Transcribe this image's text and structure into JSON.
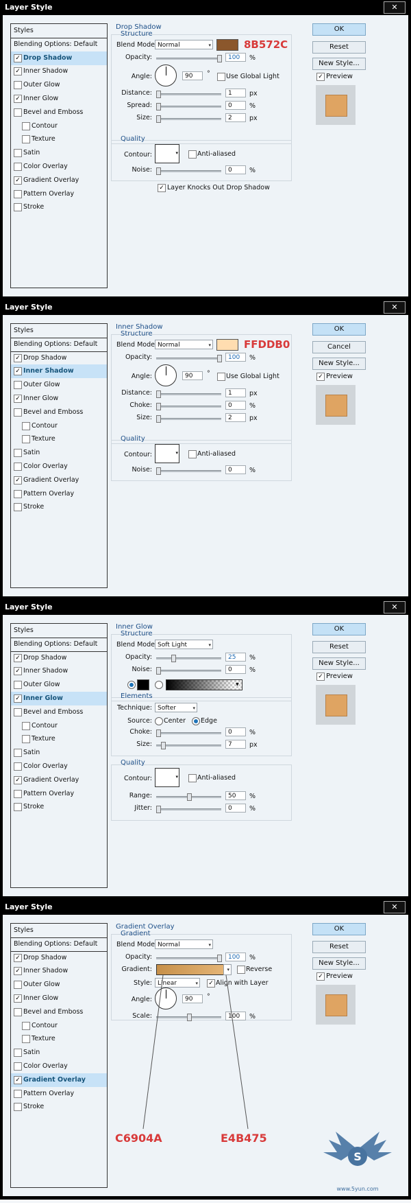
{
  "dialogs": [
    {
      "title": "Layer Style",
      "style_list": {
        "header": "Styles",
        "blending": "Blending Options: Default",
        "items": [
          {
            "label": "Drop Shadow",
            "checked": true,
            "selected": true
          },
          {
            "label": "Inner Shadow",
            "checked": true,
            "selected": false
          },
          {
            "label": "Outer Glow",
            "checked": false,
            "selected": false
          },
          {
            "label": "Inner Glow",
            "checked": true,
            "selected": false
          },
          {
            "label": "Bevel and Emboss",
            "checked": false,
            "selected": false
          },
          {
            "label": "Contour",
            "checked": false,
            "selected": false
          },
          {
            "label": "Texture",
            "checked": false,
            "selected": false
          },
          {
            "label": "Satin",
            "checked": false,
            "selected": false
          },
          {
            "label": "Color Overlay",
            "checked": false,
            "selected": false
          },
          {
            "label": "Gradient Overlay",
            "checked": true,
            "selected": false
          },
          {
            "label": "Pattern Overlay",
            "checked": false,
            "selected": false
          },
          {
            "label": "Stroke",
            "checked": false,
            "selected": false
          }
        ]
      },
      "section_title": "Drop Shadow",
      "structure_title": "Structure",
      "blend_mode_label": "Blend Mode:",
      "blend_mode_value": "Normal",
      "color_hex": "#8B572C",
      "color_annotation": "8B572C",
      "opacity_label": "Opacity:",
      "opacity_value": "100",
      "opacity_level": 1.0,
      "pct": "%",
      "angle_label": "Angle:",
      "angle_value": "90",
      "degree": "°",
      "global_light_label": "Use Global Light",
      "global_light_checked": false,
      "distance_label": "Distance:",
      "distance_value": "1",
      "spread_label": "Spread:",
      "spread_value": "0",
      "size_label": "Size:",
      "size_value": "2",
      "px": "px",
      "quality_title": "Quality",
      "contour_label": "Contour:",
      "anti_aliased_label": "Anti-aliased",
      "noise_label": "Noise:",
      "noise_value": "0",
      "knockout_label": "Layer Knocks Out Drop Shadow",
      "knockout_checked": true,
      "buttons": {
        "ok": "OK",
        "secondary": "Reset",
        "new_style": "New Style...",
        "preview": "Preview"
      }
    },
    {
      "title": "Layer Style",
      "style_list": {
        "header": "Styles",
        "blending": "Blending Options: Default",
        "items": [
          {
            "label": "Drop Shadow",
            "checked": true,
            "selected": false
          },
          {
            "label": "Inner Shadow",
            "checked": true,
            "selected": true
          },
          {
            "label": "Outer Glow",
            "checked": false,
            "selected": false
          },
          {
            "label": "Inner Glow",
            "checked": true,
            "selected": false
          },
          {
            "label": "Bevel and Emboss",
            "checked": false,
            "selected": false
          },
          {
            "label": "Contour",
            "checked": false,
            "selected": false
          },
          {
            "label": "Texture",
            "checked": false,
            "selected": false
          },
          {
            "label": "Satin",
            "checked": false,
            "selected": false
          },
          {
            "label": "Color Overlay",
            "checked": false,
            "selected": false
          },
          {
            "label": "Gradient Overlay",
            "checked": true,
            "selected": false
          },
          {
            "label": "Pattern Overlay",
            "checked": false,
            "selected": false
          },
          {
            "label": "Stroke",
            "checked": false,
            "selected": false
          }
        ]
      },
      "section_title": "Inner Shadow",
      "structure_title": "Structure",
      "blend_mode_label": "Blend Mode:",
      "blend_mode_value": "Normal",
      "color_hex": "#FFDDB0",
      "color_annotation": "FFDDB0",
      "opacity_label": "Opacity:",
      "opacity_value": "100",
      "opacity_level": 1.0,
      "pct": "%",
      "angle_label": "Angle:",
      "angle_value": "90",
      "degree": "°",
      "global_light_label": "Use Global Light",
      "global_light_checked": false,
      "distance_label": "Distance:",
      "distance_value": "1",
      "choke_label": "Choke:",
      "choke_value": "0",
      "size_label": "Size:",
      "size_value": "2",
      "px": "px",
      "quality_title": "Quality",
      "contour_label": "Contour:",
      "anti_aliased_label": "Anti-aliased",
      "noise_label": "Noise:",
      "noise_value": "0",
      "buttons": {
        "ok": "OK",
        "secondary": "Cancel",
        "new_style": "New Style...",
        "preview": "Preview"
      }
    },
    {
      "title": "Layer Style",
      "style_list": {
        "header": "Styles",
        "blending": "Blending Options: Default",
        "items": [
          {
            "label": "Drop Shadow",
            "checked": true,
            "selected": false
          },
          {
            "label": "Inner Shadow",
            "checked": true,
            "selected": false
          },
          {
            "label": "Outer Glow",
            "checked": false,
            "selected": false
          },
          {
            "label": "Inner Glow",
            "checked": true,
            "selected": true
          },
          {
            "label": "Bevel and Emboss",
            "checked": false,
            "selected": false
          },
          {
            "label": "Contour",
            "checked": false,
            "selected": false
          },
          {
            "label": "Texture",
            "checked": false,
            "selected": false
          },
          {
            "label": "Satin",
            "checked": false,
            "selected": false
          },
          {
            "label": "Color Overlay",
            "checked": false,
            "selected": false
          },
          {
            "label": "Gradient Overlay",
            "checked": true,
            "selected": false
          },
          {
            "label": "Pattern Overlay",
            "checked": false,
            "selected": false
          },
          {
            "label": "Stroke",
            "checked": false,
            "selected": false
          }
        ]
      },
      "section_title": "Inner Glow",
      "structure_title": "Structure",
      "blend_mode_label": "Blend Mode:",
      "blend_mode_value": "Soft Light",
      "opacity_label": "Opacity:",
      "opacity_value": "25",
      "opacity_level": 0.25,
      "noise_label": "Noise:",
      "noise_value": "0",
      "pct": "%",
      "glow_color_hex": "#000000",
      "elements_title": "Elements",
      "technique_label": "Technique:",
      "technique_value": "Softer",
      "source_label": "Source:",
      "source_center": "Center",
      "source_edge": "Edge",
      "choke_label": "Choke:",
      "choke_value": "0",
      "size_label": "Size:",
      "size_value": "7",
      "px": "px",
      "quality_title": "Quality",
      "contour_label": "Contour:",
      "anti_aliased_label": "Anti-aliased",
      "range_label": "Range:",
      "range_value": "50",
      "range_level": 0.5,
      "jitter_label": "Jitter:",
      "jitter_value": "0",
      "buttons": {
        "ok": "OK",
        "secondary": "Reset",
        "new_style": "New Style...",
        "preview": "Preview"
      }
    },
    {
      "title": "Layer Style",
      "style_list": {
        "header": "Styles",
        "blending": "Blending Options: Default",
        "items": [
          {
            "label": "Drop Shadow",
            "checked": true,
            "selected": false
          },
          {
            "label": "Inner Shadow",
            "checked": true,
            "selected": false
          },
          {
            "label": "Outer Glow",
            "checked": false,
            "selected": false
          },
          {
            "label": "Inner Glow",
            "checked": true,
            "selected": false
          },
          {
            "label": "Bevel and Emboss",
            "checked": false,
            "selected": false
          },
          {
            "label": "Contour",
            "checked": false,
            "selected": false
          },
          {
            "label": "Texture",
            "checked": false,
            "selected": false
          },
          {
            "label": "Satin",
            "checked": false,
            "selected": false
          },
          {
            "label": "Color Overlay",
            "checked": false,
            "selected": false
          },
          {
            "label": "Gradient Overlay",
            "checked": true,
            "selected": true
          },
          {
            "label": "Pattern Overlay",
            "checked": false,
            "selected": false
          },
          {
            "label": "Stroke",
            "checked": false,
            "selected": false
          }
        ]
      },
      "section_title": "Gradient Overlay",
      "structure_title": "Gradient",
      "blend_mode_label": "Blend Mode:",
      "blend_mode_value": "Normal",
      "opacity_label": "Opacity:",
      "opacity_value": "100",
      "opacity_level": 1.0,
      "pct": "%",
      "gradient_label": "Gradient:",
      "gradient_start_hex": "#C6904A",
      "gradient_end_hex": "#E4B475",
      "reverse_label": "Reverse",
      "style_label": "Style:",
      "style_value": "Linear",
      "align_label": "Align with Layer",
      "angle_label": "Angle:",
      "angle_value": "90",
      "degree": "°",
      "scale_label": "Scale:",
      "scale_value": "100",
      "scale_level": 0.5,
      "annotation_start": "C6904A",
      "annotation_end": "E4B475",
      "buttons": {
        "ok": "OK",
        "secondary": "Reset",
        "new_style": "New Style...",
        "preview": "Preview"
      }
    }
  ],
  "close_glyph": "✕",
  "check_glyph": "✓",
  "arrow_glyph": "▾",
  "watermark_text": "www.5yun.com",
  "colors": {
    "accent": "#1d4f88",
    "selected_row": "#c7e2f7",
    "annotation_red": "#d83a3a",
    "preview_fill": "#dfa462"
  }
}
